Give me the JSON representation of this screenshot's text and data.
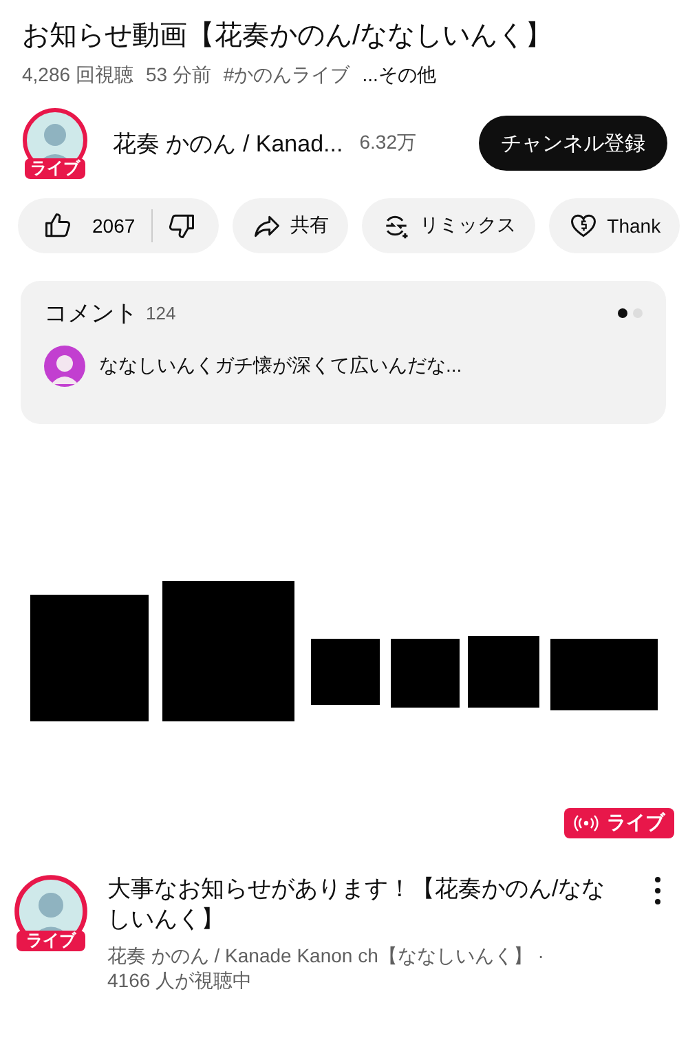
{
  "video": {
    "title": "お知らせ動画【花奏かのん/ななしいんく】",
    "views": "4,286 回視聴",
    "age": "53 分前",
    "hashtag": "#かのんライブ",
    "more": "...その他"
  },
  "channel": {
    "live_badge": "ライブ",
    "name": "花奏 かのん / Kanad...",
    "subscribers": "6.32万",
    "subscribe": "チャンネル登録"
  },
  "actions": {
    "likes": "2067",
    "buttons": [
      {
        "kind": "share",
        "label": "共有"
      },
      {
        "kind": "remix",
        "label": "リミックス"
      },
      {
        "kind": "thanks",
        "label": "Thank"
      }
    ]
  },
  "comments": {
    "title": "コメント",
    "count": "124",
    "pages": [
      {
        "selected": true
      },
      {
        "selected": false
      }
    ],
    "top_comment": "ななしいんくガチ懐が深くて広いんだな..."
  },
  "next_video": {
    "thumbnail": {
      "kind": "picture",
      "badge": "ライブ"
    },
    "avatar_badge": "ライブ",
    "title": "大事なお知らせがあります！【花奏かのん/ななしいんく】",
    "channel": "花奏 かのん / Kanade Kanon ch【ななしいんく】 ·",
    "viewers": "4166 人が視聴中"
  }
}
